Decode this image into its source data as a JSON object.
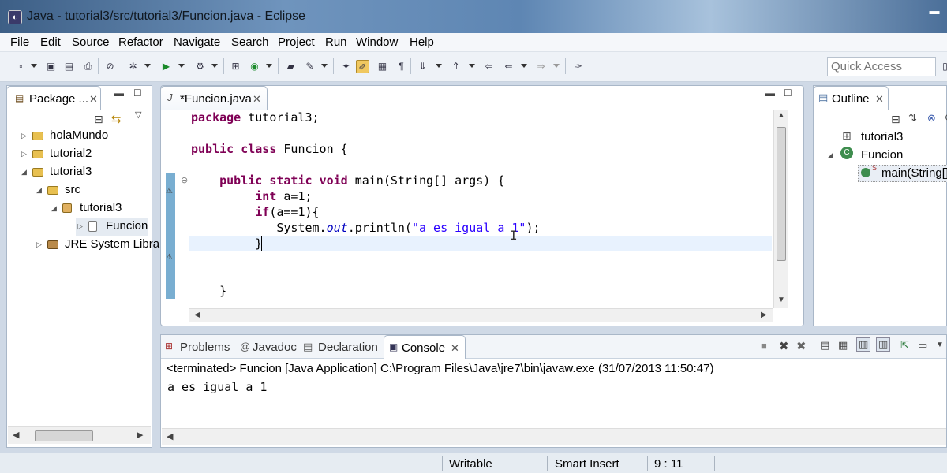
{
  "window": {
    "title": "Java - tutorial3/src/tutorial3/Funcion.java - Eclipse"
  },
  "menubar": [
    "File",
    "Edit",
    "Source",
    "Refactor",
    "Navigate",
    "Search",
    "Project",
    "Run",
    "Window",
    "Help"
  ],
  "toolbar": {
    "quick_access_placeholder": "Quick Access"
  },
  "package_explorer": {
    "tab_label": "Package ...",
    "tree": [
      {
        "label": "holaMundo",
        "level": 0,
        "icon": "project-icon",
        "arrow": "collapsed"
      },
      {
        "label": "tutorial2",
        "level": 0,
        "icon": "project-icon",
        "arrow": "collapsed"
      },
      {
        "label": "tutorial3",
        "level": 0,
        "icon": "project-icon",
        "arrow": "expanded"
      },
      {
        "label": "src",
        "level": 1,
        "icon": "source-folder-icon",
        "arrow": "expanded"
      },
      {
        "label": "tutorial3",
        "level": 2,
        "icon": "package-icon",
        "arrow": "expanded"
      },
      {
        "label": "Funcion.ja",
        "level": 3,
        "icon": "java-file-icon",
        "arrow": "collapsed"
      },
      {
        "label": "JRE System Libra",
        "level": 1,
        "icon": "library-icon",
        "arrow": "collapsed"
      }
    ]
  },
  "editor": {
    "tab_label": "*Funcion.java",
    "code_lines": [
      [
        {
          "t": "package",
          "c": "kw"
        },
        {
          "t": " tutorial3;",
          "c": ""
        }
      ],
      [],
      [
        {
          "t": "public",
          "c": "kw"
        },
        {
          "t": " ",
          "c": ""
        },
        {
          "t": "class",
          "c": "kw"
        },
        {
          "t": " Funcion {",
          "c": ""
        }
      ],
      [],
      [
        {
          "t": "    ",
          "c": ""
        },
        {
          "t": "public",
          "c": "kw"
        },
        {
          "t": " ",
          "c": ""
        },
        {
          "t": "static",
          "c": "kw"
        },
        {
          "t": " ",
          "c": ""
        },
        {
          "t": "void",
          "c": "kw"
        },
        {
          "t": " main(String[] args) {",
          "c": ""
        }
      ],
      [
        {
          "t": "         ",
          "c": ""
        },
        {
          "t": "int",
          "c": "kw"
        },
        {
          "t": " a=1;",
          "c": ""
        }
      ],
      [
        {
          "t": "         ",
          "c": ""
        },
        {
          "t": "if",
          "c": "kw"
        },
        {
          "t": "(a==1){",
          "c": ""
        }
      ],
      [
        {
          "t": "            System.",
          "c": ""
        },
        {
          "t": "out",
          "c": "ital"
        },
        {
          "t": ".println(",
          "c": ""
        },
        {
          "t": "\"a es igual a 1\"",
          "c": "str"
        },
        {
          "t": ");",
          "c": ""
        }
      ],
      [
        {
          "t": "         }",
          "c": ""
        }
      ],
      [],
      [],
      [
        {
          "t": "    }",
          "c": ""
        }
      ]
    ]
  },
  "outline": {
    "tab_label": "Outline",
    "items": [
      {
        "label": "tutorial3",
        "icon": "package-decl-icon"
      },
      {
        "label": "Funcion",
        "icon": "class-icon"
      },
      {
        "label": "main(String[]",
        "icon": "method-icon"
      }
    ]
  },
  "console": {
    "tabs": [
      "Problems",
      "Javadoc",
      "Declaration",
      "Console"
    ],
    "header": "<terminated> Funcion [Java Application] C:\\Program Files\\Java\\jre7\\bin\\javaw.exe (31/07/2013 11:50:47)",
    "output": "a es igual a 1"
  },
  "statusbar": {
    "writable": "Writable",
    "insert_mode": "Smart Insert",
    "position": "9 : 11"
  }
}
